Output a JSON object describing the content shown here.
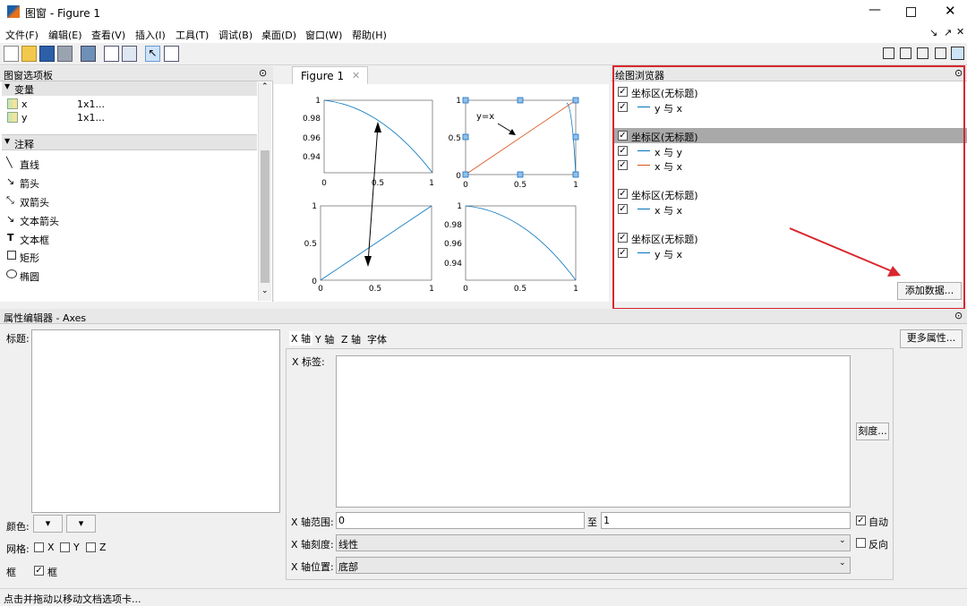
{
  "window": {
    "title": "图窗 - Figure 1"
  },
  "menu": [
    "文件(F)",
    "编辑(E)",
    "查看(V)",
    "插入(I)",
    "工具(T)",
    "调试(B)",
    "桌面(D)",
    "窗口(W)",
    "帮助(H)"
  ],
  "left_panel": {
    "title": "图窗选项板",
    "variables_header": "变量",
    "variables": [
      {
        "name": "x",
        "size": "1x1..."
      },
      {
        "name": "y",
        "size": "1x1..."
      }
    ],
    "annotations_header": "注释",
    "annotations": [
      "直线",
      "箭头",
      "双箭头",
      "文本箭头",
      "文本框",
      "矩形",
      "椭圆"
    ]
  },
  "figure_tab": "Figure 1",
  "subplots": {
    "annotation_text": "y=x",
    "ticks_a": {
      "y": [
        "1",
        "0.98",
        "0.96",
        "0.94"
      ],
      "x": [
        "0",
        "0.5",
        "1"
      ]
    },
    "ticks_b": {
      "y": [
        "1",
        "0.5",
        "0"
      ],
      "x": [
        "0",
        "0.5",
        "1"
      ]
    },
    "ticks_c": {
      "y": [
        "1",
        "0.5",
        "0"
      ],
      "x": [
        "0",
        "0.5",
        "1"
      ]
    },
    "ticks_d": {
      "y": [
        "1",
        "0.98",
        "0.96",
        "0.94"
      ],
      "x": [
        "0",
        "0.5",
        "1"
      ]
    }
  },
  "browser": {
    "title": "绘图浏览器",
    "groups": [
      {
        "axes": "坐标区(无标题)",
        "selected": false,
        "series": [
          {
            "label": "y 与 x",
            "color": "#0072bd"
          }
        ]
      },
      {
        "axes": "坐标区(无标题)",
        "selected": true,
        "series": [
          {
            "label": "x 与 y",
            "color": "#0072bd"
          },
          {
            "label": "x 与 x",
            "color": "#d95319"
          }
        ]
      },
      {
        "axes": "坐标区(无标题)",
        "selected": false,
        "series": [
          {
            "label": "x 与 x",
            "color": "#0072bd"
          }
        ]
      },
      {
        "axes": "坐标区(无标题)",
        "selected": false,
        "series": [
          {
            "label": "y 与 x",
            "color": "#0072bd"
          }
        ]
      }
    ],
    "add_data": "添加数据..."
  },
  "prop_editor": {
    "title": "属性编辑器 - Axes",
    "title_label": "标题:",
    "color_label": "颜色:",
    "grid_label": "网格:",
    "grid_x": "X",
    "grid_y": "Y",
    "grid_z": "Z",
    "box_label": "框",
    "box_check": "框",
    "tabs": [
      "X 轴",
      "Y 轴",
      "Z 轴",
      "字体"
    ],
    "xlabel_label": "X 标签:",
    "ticks_button": "刻度...",
    "range_label": "X 轴范围:",
    "range_min": "0",
    "range_to": "至",
    "range_max": "1",
    "auto": "自动",
    "scale_label": "X 轴刻度:",
    "scale_value": "线性",
    "reverse": "反向",
    "location_label": "X 轴位置:",
    "location_value": "底部",
    "more_props": "更多属性..."
  },
  "status": "点击并拖动以移动文档选项卡...",
  "colors": {
    "highlight": "#d9262e",
    "line_blue": "#0072bd",
    "line_orange": "#d95319"
  }
}
